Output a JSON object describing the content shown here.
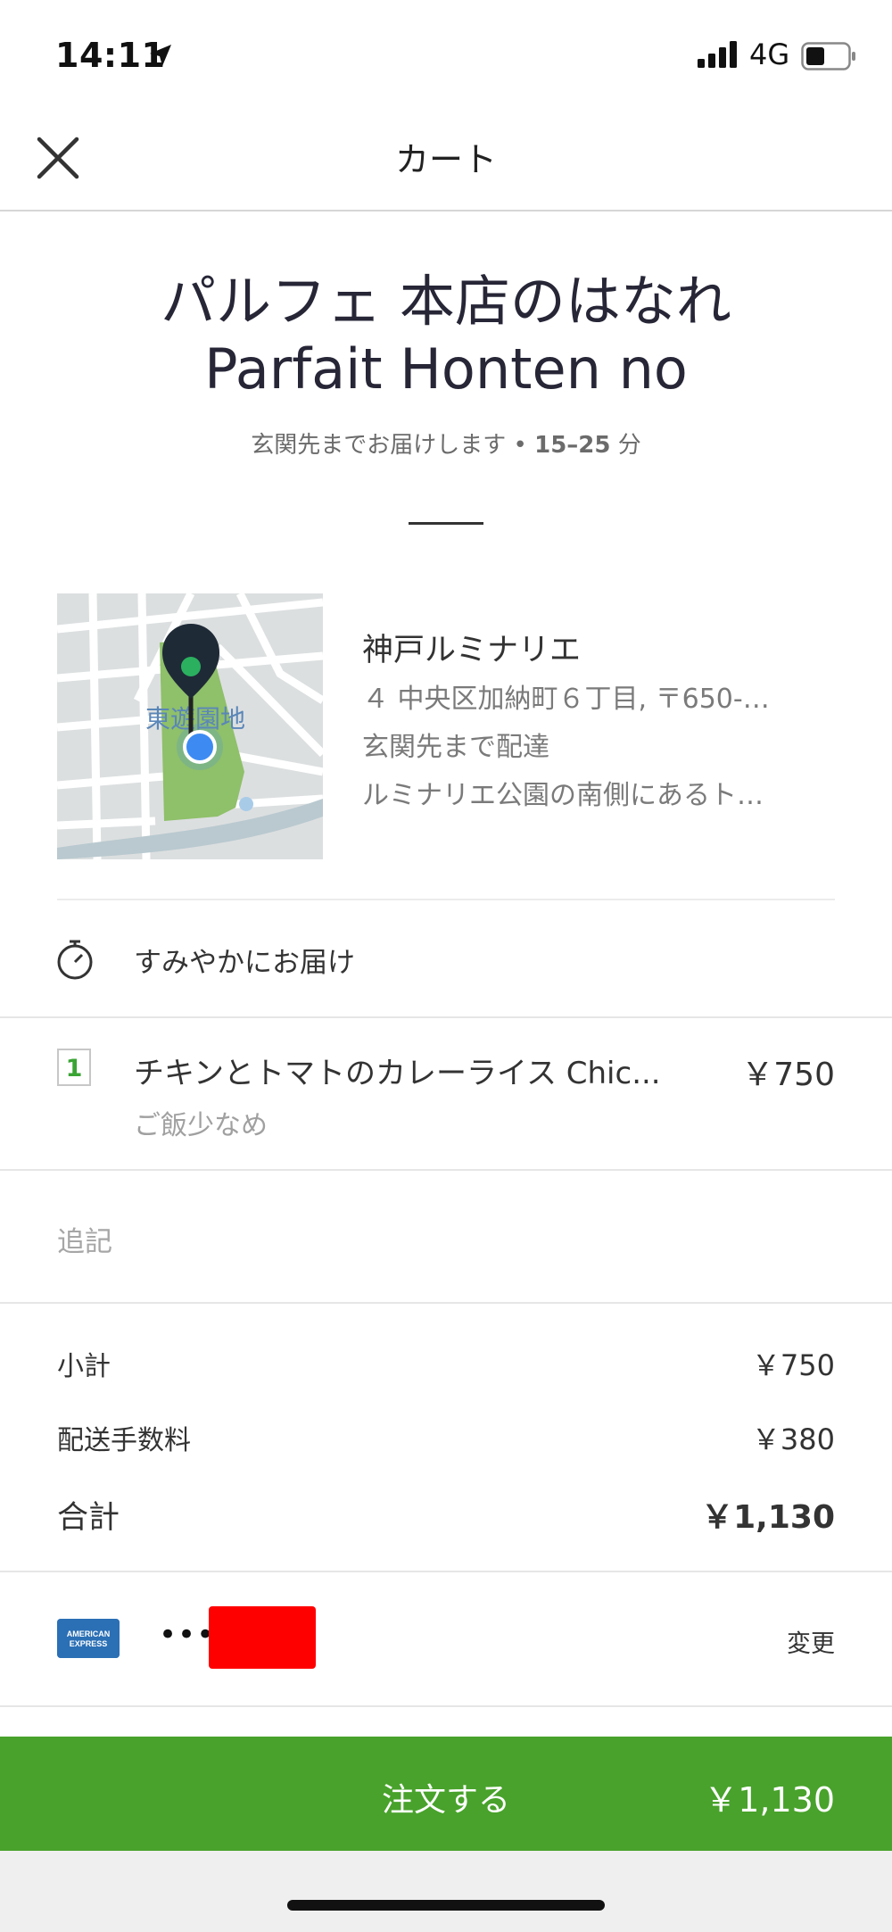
{
  "status_bar": {
    "time": "14:11",
    "network": "4G"
  },
  "header": {
    "title": "カート"
  },
  "restaurant": {
    "name_ja": "パルフェ 本店のはなれ",
    "name_en": "Parfait Honten no",
    "delivery_text": "玄関先までお届けします •",
    "eta_range": "15–25",
    "eta_unit": "分"
  },
  "map": {
    "label": "東遊園地"
  },
  "address": {
    "name": "神戸ルミナリエ",
    "line1": "４ 中央区加納町６丁目, 〒650-…",
    "line2": "玄関先まで配達",
    "line3": "ルミナリエ公園の南側にあるト…"
  },
  "delivery_option": {
    "label": "すみやかにお届け"
  },
  "cart_items": [
    {
      "qty": "1",
      "name": "チキンとトマトのカレーライス Chic...",
      "price": "￥750",
      "note": "ご飯少なめ"
    }
  ],
  "notes": {
    "placeholder": "追記"
  },
  "summary": {
    "subtotal_label": "小計",
    "subtotal": "￥750",
    "fee_label": "配送手数料",
    "fee": "￥380",
    "total_label": "合計",
    "total": "￥1,130"
  },
  "payment": {
    "card_brand": "AMERICAN EXPRESS",
    "masked": "••••",
    "change_label": "変更"
  },
  "order_button": {
    "label": "注文する",
    "price": "￥1,130"
  },
  "colors": {
    "accent_green": "#48a22b",
    "qty_green": "#3aa434",
    "amex_blue": "#2b6fb5",
    "map_park": "#8fc06a",
    "pin_blue": "#3d8bf2"
  }
}
